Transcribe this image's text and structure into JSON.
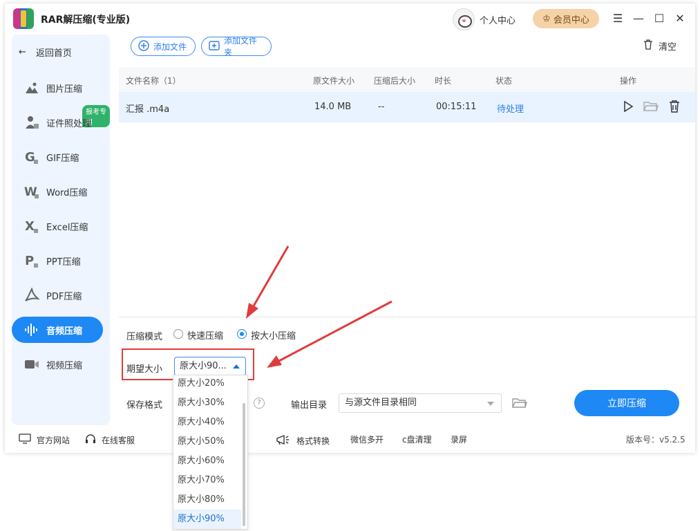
{
  "app": {
    "title": "RAR解压缩(专业版)",
    "personal_center": "个人中心",
    "vip_center": "会员中心"
  },
  "sidebar": {
    "back": "返回首页",
    "badge": "报考专用",
    "items": [
      {
        "label": "图片压缩",
        "icon": "image-icon"
      },
      {
        "label": "证件照处理",
        "icon": "id-photo-icon"
      },
      {
        "label": "GIF压缩",
        "icon": "gif-icon"
      },
      {
        "label": "Word压缩",
        "icon": "word-icon"
      },
      {
        "label": "Excel压缩",
        "icon": "excel-icon"
      },
      {
        "label": "PPT压缩",
        "icon": "ppt-icon"
      },
      {
        "label": "PDF压缩",
        "icon": "pdf-icon"
      },
      {
        "label": "音频压缩",
        "icon": "audio-icon",
        "active": true
      },
      {
        "label": "视频压缩",
        "icon": "video-icon"
      }
    ]
  },
  "toolbar": {
    "add_file": "添加文件",
    "add_folder": "添加文件夹",
    "clear": "清空"
  },
  "table": {
    "headers": {
      "name": "文件名称（1）",
      "orig_size": "原文件大小",
      "comp_size": "压缩后大小",
      "duration": "时长",
      "status": "状态",
      "actions": "操作"
    },
    "rows": [
      {
        "name": "汇报 .m4a",
        "orig_size": "14.0 MB",
        "comp_size": "--",
        "duration": "00:15:11",
        "status": "待处理"
      }
    ]
  },
  "settings": {
    "mode_label": "压缩模式",
    "mode_fast": "快速压缩",
    "mode_size": "按大小压缩",
    "mode_selected": "按大小压缩",
    "expected_label": "期望大小",
    "expected_value": "原大小90...",
    "save_format_label": "保存格式",
    "output_dir_label": "输出目录",
    "output_dir_value": "与源文件目录相同",
    "compress_button": "立即压缩"
  },
  "dropdown": {
    "options": [
      "原大小20%",
      "原大小30%",
      "原大小40%",
      "原大小50%",
      "原大小60%",
      "原大小70%",
      "原大小80%",
      "原大小90%"
    ],
    "selected": "原大小90%"
  },
  "footer": {
    "website": "官方网站",
    "service": "在线客服",
    "format_convert": "格式转换",
    "wechat_multi": "微信多开",
    "c_clean": "c盘清理",
    "record": "录屏",
    "version": "版本号：v5.2.5"
  },
  "colors": {
    "accent": "#1e88f5",
    "annotation": "#e23b3b",
    "badge": "#2fb36a"
  }
}
